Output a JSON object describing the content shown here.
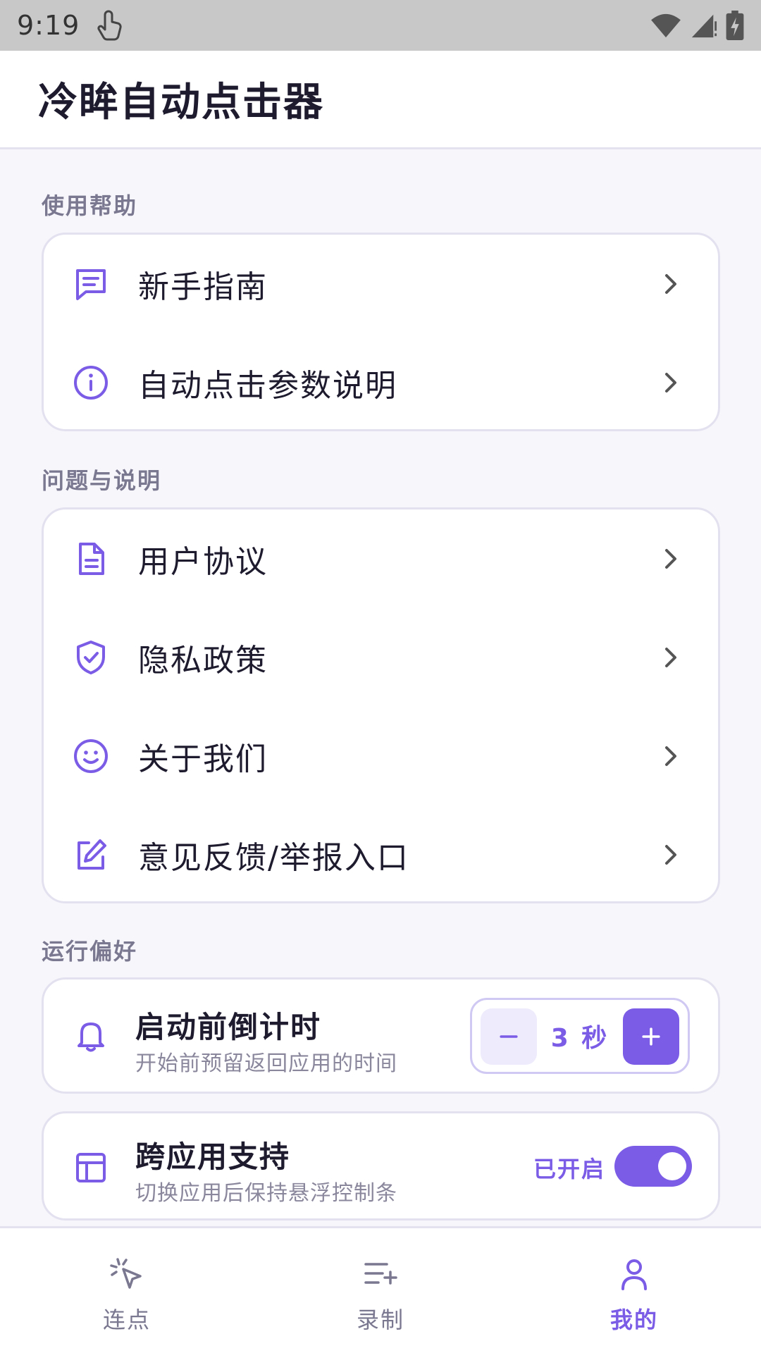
{
  "status_bar": {
    "time": "9:19"
  },
  "app_bar": {
    "title": "冷眸自动点击器"
  },
  "sections": {
    "help": {
      "label": "使用帮助",
      "items": [
        {
          "label": "新手指南",
          "icon": "message-lines-icon"
        },
        {
          "label": "自动点击参数说明",
          "icon": "info-icon"
        }
      ]
    },
    "issues": {
      "label": "问题与说明",
      "items": [
        {
          "label": "用户协议",
          "icon": "document-icon"
        },
        {
          "label": "隐私政策",
          "icon": "shield-check-icon"
        },
        {
          "label": "关于我们",
          "icon": "smiley-icon"
        },
        {
          "label": "意见反馈/举报入口",
          "icon": "edit-icon"
        }
      ]
    },
    "preferences": {
      "label": "运行偏好",
      "countdown": {
        "title": "启动前倒计时",
        "subtitle": "开始前预留返回应用的时间",
        "value": "3 秒",
        "icon": "bell-icon"
      },
      "cross_app": {
        "title": "跨应用支持",
        "subtitle": "切换应用后保持悬浮控制条",
        "status": "已开启",
        "enabled": true,
        "icon": "layout-icon"
      }
    }
  },
  "bottom_nav": {
    "items": [
      {
        "label": "连点",
        "icon": "cursor-click-icon",
        "active": false
      },
      {
        "label": "录制",
        "icon": "list-plus-icon",
        "active": false
      },
      {
        "label": "我的",
        "icon": "user-icon",
        "active": true
      }
    ]
  },
  "colors": {
    "accent": "#7a5ce6",
    "accent_light": "#eeebfc",
    "text": "#1e1b2e",
    "muted": "#7a7790"
  }
}
